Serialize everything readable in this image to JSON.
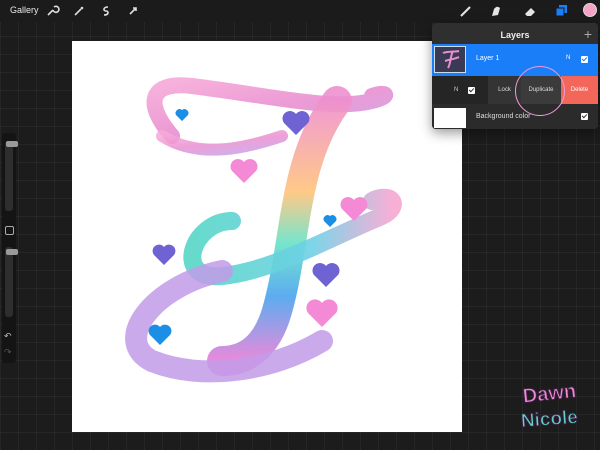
{
  "toolbar": {
    "gallery_label": "Gallery",
    "left_tools": [
      "wrench-icon",
      "magic-wand-icon",
      "selection-icon",
      "transform-icon"
    ],
    "right_tools": [
      "brush-icon",
      "smudge-icon",
      "eraser-icon",
      "layers-icon"
    ],
    "active_color": "#f4a3c6"
  },
  "layers_panel": {
    "title": "Layers",
    "add_symbol": "+",
    "layers": [
      {
        "name": "Layer 1",
        "blend_mode": "N",
        "visible": true,
        "selected": true
      },
      {
        "name": "Background color",
        "visible": true
      }
    ],
    "swipe_row": {
      "blend_mode": "N",
      "visible": true
    },
    "actions": {
      "lock": "Lock",
      "duplicate": "Duplicate",
      "delete": "Delete"
    },
    "accent": "#1a7ef9",
    "delete_color": "#f2675a"
  },
  "side_bar": {
    "undo_symbol": "↶",
    "redo_symbol": "↷"
  },
  "signature": {
    "line1": "Dawn",
    "line2": "Nicole"
  }
}
